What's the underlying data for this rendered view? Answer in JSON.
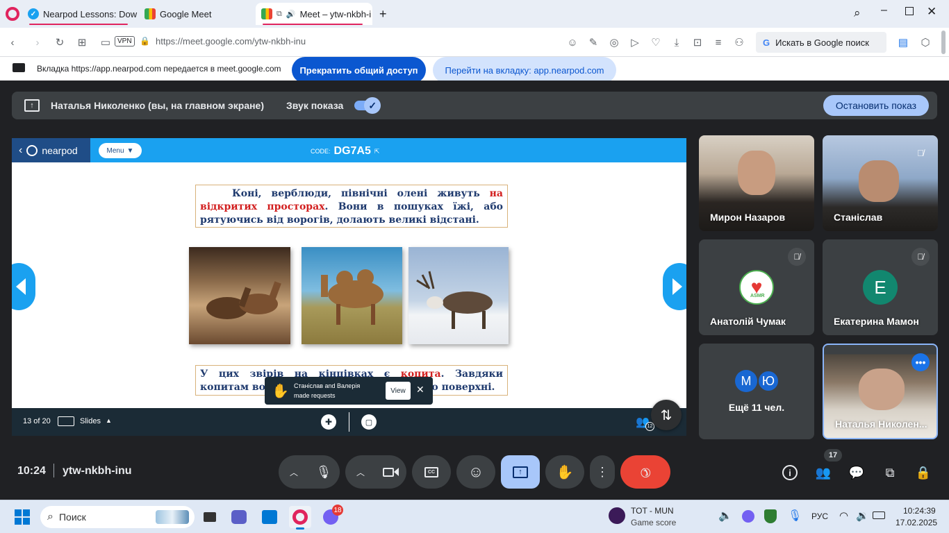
{
  "browser": {
    "tabs": [
      {
        "label": "Nearpod Lessons: Downlo",
        "icon": "nearpod-favicon"
      },
      {
        "label": "Google Meet",
        "icon": "google-meet-favicon"
      },
      {
        "label": "Meet – ytw-nkbh-i",
        "icon": "google-meet-favicon",
        "active": true
      }
    ],
    "vpn_label": "VPN",
    "url": "https://meet.google.com/ytw-nkbh-inu",
    "search_placeholder": "Искать в Google поиск"
  },
  "share_bar": {
    "message": "Вкладка https://app.nearpod.com передается в meet.google.com",
    "stop_sharing_label": "Прекратить общий доступ",
    "switch_tab_label": "Перейти на вкладку: app.nearpod.com"
  },
  "presenter_bar": {
    "presenter": "Наталья Николенко (вы, на главном экране)",
    "audio_label": "Звук показа",
    "audio_on": true,
    "stop_label": "Остановить показ"
  },
  "nearpod": {
    "logo": "nearpod",
    "menu_label": "Menu",
    "code_label": "CODE:",
    "code": "DG7A5",
    "slide": {
      "text_top_1": "Коні, верблюди, північні олені живуть ",
      "text_top_red": "на відкритих просторах",
      "text_top_2": ". Вони в пошуках їжі, або рятуючись від ворогів, долають великі відстані.",
      "text_bottom_1": "У цих звірів на кінцівках є ",
      "text_bottom_red": "копита",
      "text_bottom_2": ". Завдяки копитам вони швидше пересуваються по поверхні.",
      "images": [
        "horses-photo",
        "camel-photo",
        "reindeer-photo"
      ]
    },
    "footer": {
      "page_indicator": "13 of 20",
      "slides_label": "Slides",
      "participants_count": "12"
    },
    "toast": {
      "line1": "Станіслав and Валерія",
      "line2": "made requests",
      "view_label": "View"
    }
  },
  "participants": [
    {
      "name": "Мирон Назаров",
      "muted": false,
      "type": "video"
    },
    {
      "name": "Станіслав",
      "muted": true,
      "type": "video"
    },
    {
      "name": "Анатолій Чумак",
      "muted": true,
      "type": "avatar",
      "avatar": "ASMR"
    },
    {
      "name": "Екатерина Мамон",
      "muted": true,
      "type": "avatar",
      "avatar": "Е"
    },
    {
      "name": "Ещё 11 чел.",
      "type": "more",
      "avatars": [
        "М",
        "Ю"
      ]
    },
    {
      "name": "Наталья Николен...",
      "type": "video",
      "self": true
    }
  ],
  "controls": {
    "time": "10:24",
    "meeting_code": "ytw-nkbh-inu",
    "people_count": "17"
  },
  "taskbar": {
    "search_placeholder": "Поиск",
    "notif_badge": "18",
    "game_title": "TOT - MUN",
    "game_subtitle": "Game score",
    "lang": "РУС",
    "time": "10:24:39",
    "date": "17.02.2025"
  },
  "colors": {
    "nearpod_blue": "#1aa1f0",
    "nearpod_dark": "#1b2b36",
    "meet_bg": "#202124",
    "end_call": "#ea4335",
    "present_active": "#a8c7fa"
  }
}
